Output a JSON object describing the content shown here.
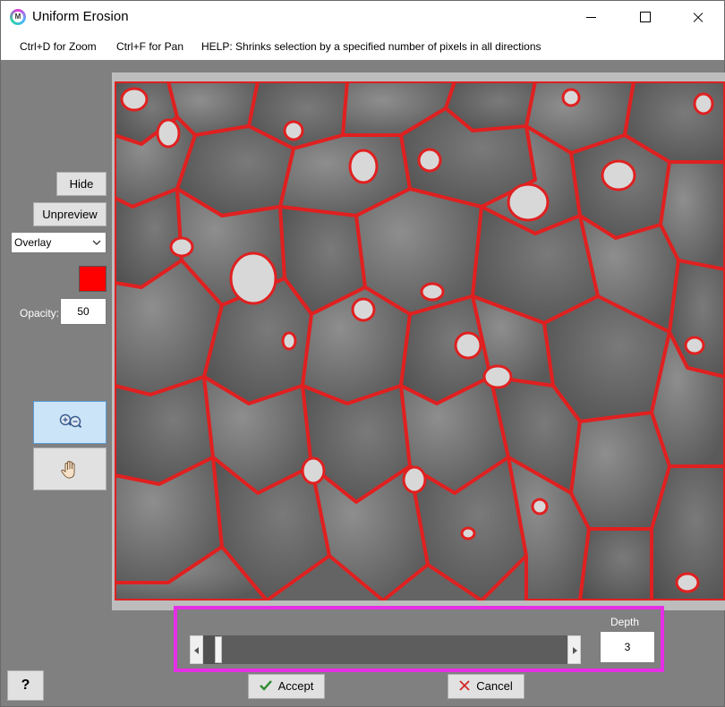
{
  "window": {
    "title": "Uniform Erosion",
    "app_icon": "m-logo-icon",
    "controls": [
      "minimize-icon",
      "maximize-icon",
      "close-icon"
    ]
  },
  "menubar": {
    "zoom_hint": "Ctrl+D for Zoom",
    "pan_hint": "Ctrl+F for Pan",
    "help_text": "HELP:  Shrinks selection by a specified number of pixels in all directions"
  },
  "sidebar": {
    "hide_label": "Hide",
    "unpreview_label": "Unpreview",
    "mode_selected": "Overlay",
    "overlay_color": "#ff0000",
    "opacity_label": "Opacity:",
    "opacity_value": "50",
    "tools": [
      "zoom-icon",
      "pan-hand-icon"
    ],
    "active_tool": "zoom"
  },
  "depth": {
    "label": "Depth",
    "value": "3"
  },
  "footer": {
    "accept_label": "Accept",
    "cancel_label": "Cancel",
    "help_label": "?"
  },
  "colors": {
    "background": "#808080",
    "overlay": "#ff0000",
    "panel_highlight": "#e62ee6",
    "active_tool_bg": "#cce4f7",
    "accept_icon": "#2e8b2e",
    "cancel_icon": "#d62828"
  }
}
